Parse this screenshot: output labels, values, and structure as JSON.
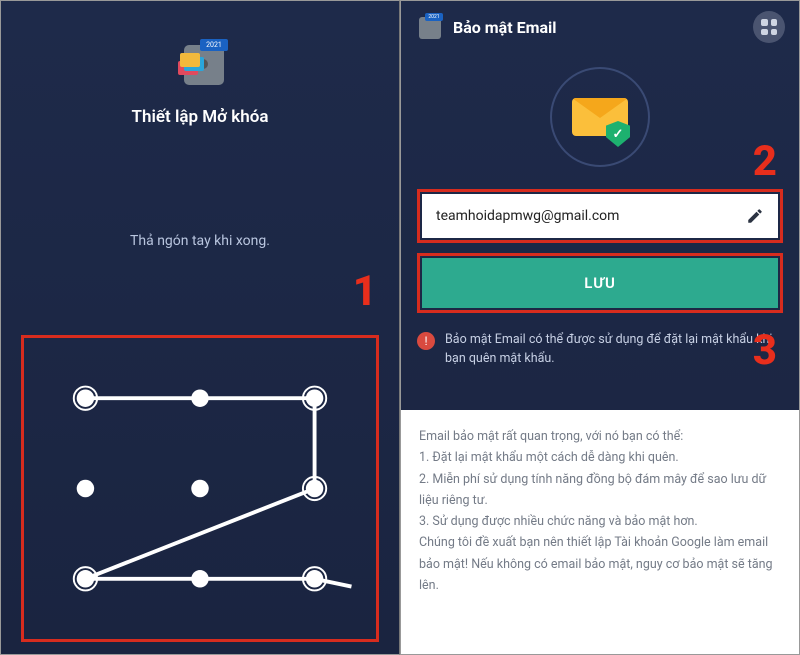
{
  "left": {
    "badge_year": "2021",
    "title": "Thiết lập Mở khóa",
    "subtitle": "Thả ngón tay khi xong.",
    "step_number": "1",
    "pattern": {
      "dots": [
        [
          0,
          0
        ],
        [
          1,
          0
        ],
        [
          2,
          0
        ],
        [
          0,
          1
        ],
        [
          1,
          1
        ],
        [
          2,
          1
        ],
        [
          0,
          2
        ],
        [
          1,
          2
        ],
        [
          2,
          2
        ]
      ],
      "path": [
        [
          0,
          0
        ],
        [
          2,
          0
        ],
        [
          2,
          1
        ],
        [
          0,
          2
        ],
        [
          2,
          2
        ]
      ]
    }
  },
  "right": {
    "badge_year": "2021",
    "title": "Bảo mật Email",
    "step2_number": "2",
    "step3_number": "3",
    "email_value": "teamhoidapmwg@gmail.com",
    "save_label": "LƯU",
    "warning_text": "Bảo mật Email có thể được sử dụng để đặt lại mật khẩu khi bạn quên mật khẩu.",
    "info": {
      "intro": "Email bảo mật rất quan trọng, với nó bạn có thể:",
      "l1": "1. Đặt lại mật khẩu một cách dễ dàng khi quên.",
      "l2": "2. Miễn phí sử dụng tính năng đồng bộ đám mây để sao lưu dữ liệu riêng tư.",
      "l3": "3. Sử dụng được nhiều chức năng và bảo mật hơn.",
      "outro": "Chúng tôi đề xuất bạn nên thiết lập Tài khoản Google làm email bảo mật! Nếu không có email bảo mật, nguy cơ bảo mật sẽ tăng lên."
    }
  }
}
